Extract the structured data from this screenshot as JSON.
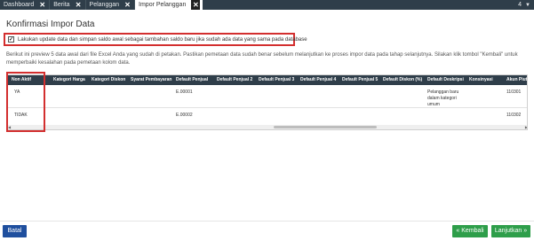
{
  "tabs": [
    {
      "label": "Dashboard",
      "closable": true,
      "active": false
    },
    {
      "label": "Berita",
      "closable": true,
      "active": false
    },
    {
      "label": "Pelanggan",
      "closable": true,
      "active": false
    },
    {
      "label": "Impor Pelanggan",
      "closable": true,
      "active": true
    }
  ],
  "tab_count": "4",
  "page_title": "Konfirmasi Impor Data",
  "update_checkbox": {
    "checked": true,
    "label": "Lakukan update data dan simpan saldo awal sebagai tambahan saldo baru jika sudah ada data yang sama pada database"
  },
  "info_text": "Berikut ini preview 5 data awal dari file Excel Anda yang sudah di petakan. Pastikan pemetaan data sudah benar sebelum melanjutkan ke proses impor data pada tahap selanjutnya. Silakan klik tombol \"Kembali\" untuk memperbaiki kesalahan pada pemetaan kolom data.",
  "table": {
    "columns": [
      "Non Aktif",
      "Kategori Harga",
      "Kategori Diskon",
      "Syarat Pembayaran",
      "Default Penjual",
      "Default Penjual 2",
      "Default Penjual 3",
      "Default Penjual 4",
      "Default Penjual 5",
      "Default Diskon (%)",
      "Default Deskripsi",
      "Konsinyasi",
      "Akun Piut"
    ],
    "rows": [
      [
        "YA",
        "",
        "",
        "",
        "E.00001",
        "",
        "",
        "",
        "",
        "",
        "Pelanggan baru dalam kategori umum",
        "",
        "110301"
      ],
      [
        "TIDAK",
        "",
        "",
        "",
        "E.00002",
        "",
        "",
        "",
        "",
        "",
        "",
        "",
        "110302"
      ]
    ]
  },
  "buttons": {
    "batal": "Batal",
    "kembali": "« Kembali",
    "lanjutkan": "Lanjutkan »"
  },
  "colors": {
    "header_dark": "#2f3e4a",
    "highlight": "#d32f2f",
    "primary": "#1f4f9e",
    "success": "#2e9e4a"
  }
}
